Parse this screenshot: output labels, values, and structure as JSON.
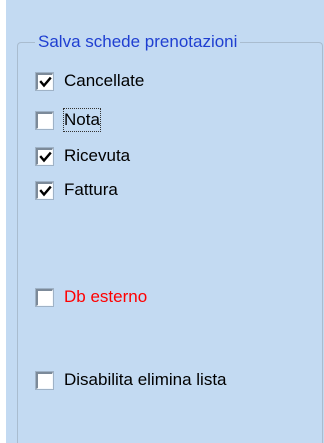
{
  "group": {
    "title": "Salva schede prenotazioni"
  },
  "checkboxes": [
    {
      "label": "Cancellate",
      "checked": true
    },
    {
      "label": "Nota",
      "checked": false
    },
    {
      "label": "Ricevuta",
      "checked": true
    },
    {
      "label": "Fattura",
      "checked": true
    },
    {
      "label": "Db esterno",
      "checked": false,
      "color": "#ff0000"
    },
    {
      "label": "Disabilita elimina lista",
      "checked": false
    }
  ],
  "colors": {
    "panel_background": "#c3daf2",
    "group_title": "#1f3fd1",
    "alert_label": "#ff0000"
  }
}
